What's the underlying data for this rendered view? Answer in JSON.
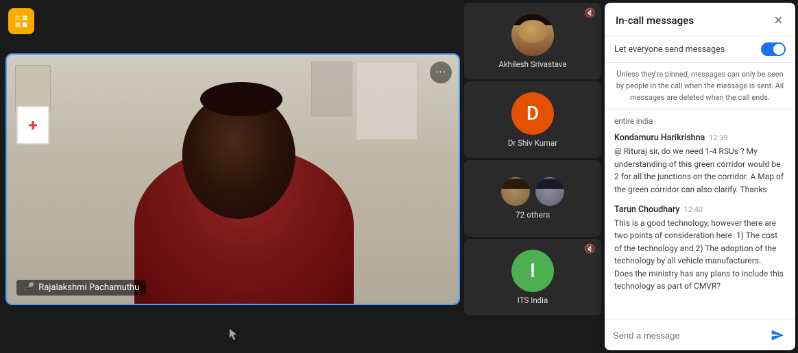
{
  "app": {
    "icon_label": "meet-icon"
  },
  "main_video": {
    "participant_name": "Rajalakshmi Pachamuthu",
    "more_options_label": "···"
  },
  "participants": [
    {
      "id": "akhilesh",
      "name": "Akhilesh Srivastava",
      "avatar_type": "photo",
      "avatar_letter": "",
      "avatar_color": "#c09060",
      "muted": true
    },
    {
      "id": "shiv",
      "name": "Dr Shiv Kumar",
      "avatar_type": "letter",
      "avatar_letter": "D",
      "avatar_color": "#e65100",
      "muted": false
    },
    {
      "id": "others",
      "name": "72 others",
      "avatar_type": "multi",
      "avatar_letter": "",
      "avatar_color": "",
      "muted": false
    },
    {
      "id": "its",
      "name": "ITS India",
      "avatar_type": "letter",
      "avatar_letter": "I",
      "avatar_color": "#4caf50",
      "muted": true
    }
  ],
  "messages_panel": {
    "title": "In-call messages",
    "close_label": "✕",
    "let_everyone_label": "Let everyone send messages",
    "toggle_on": true,
    "info_text": "Unless they're pinned, messages can only be seen by people in the call when the message is sent. All messages are deleted when the call ends.",
    "context": "entire india",
    "messages": [
      {
        "sender": "Kondamuru Harikrishna",
        "time": "12:39",
        "text": "@ Rituraj sir, do we need 1-4 RSUs ? My understanding of this green corridor would be 2 for all the junctions on the corridor. A Map of the green corridor can also clarify. Thanks"
      },
      {
        "sender": "Tarun Choudhary",
        "time": "12:40",
        "text": "This is a good technology, however there are two points of consideration here. 1) The cost of the technology and 2) The adoption of the technology by all vehicle manufacturers.\nDoes the ministry has any plans to include this technology as part of CMVR?"
      }
    ],
    "input_placeholder": "Send a message",
    "send_label": "➤"
  }
}
